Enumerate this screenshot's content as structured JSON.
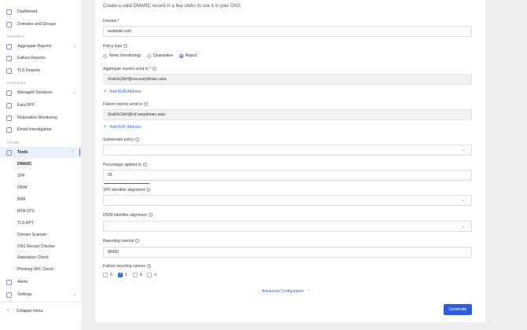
{
  "sidebar": {
    "top_items": [
      {
        "label": "Dashboard",
        "icon": "dashboard-icon"
      },
      {
        "label": "Domains and Groups",
        "icon": "domains-icon"
      }
    ],
    "reports_label": "REPORTS",
    "reports_items": [
      {
        "label": "Aggregate Reports",
        "icon": "aggregate-reports-icon",
        "chevron": "⌄"
      },
      {
        "label": "Failure Reports",
        "icon": "failure-reports-icon"
      },
      {
        "label": "TLS Reports",
        "icon": "tls-reports-icon"
      }
    ],
    "features_label": "FEATURES",
    "features_items": [
      {
        "label": "Managed Solutions",
        "icon": "managed-solutions-icon",
        "chevron": "⌄"
      },
      {
        "label": "EasySPF",
        "icon": "easyspf-icon"
      },
      {
        "label": "Reputation Monitoring",
        "icon": "reputation-monitoring-icon"
      },
      {
        "label": "Email Investigation",
        "icon": "email-investigation-icon"
      }
    ],
    "other_label": "OTHER",
    "tools": {
      "label": "Tools",
      "icon": "tools-icon",
      "chevron": "⌃"
    },
    "tools_sub": [
      "DMARC",
      "SPF",
      "DKIM",
      "BIMI",
      "MTA-STS",
      "TLS-RPT",
      "Domain Scanner",
      "DNS Record Checker",
      "Reputation Check",
      "Phishing URL Check"
    ],
    "alerts": {
      "label": "Alerts",
      "icon": "alerts-icon"
    },
    "settings": {
      "label": "Settings",
      "icon": "settings-icon",
      "chevron": "⌄"
    },
    "collapse_label": "Collapse menu"
  },
  "form": {
    "intro": "Create a valid DMARC record in a few clicks to use it in your DNS.",
    "domain_label": "Domain *",
    "domain_value": "example.com",
    "policy_label": "Policy type",
    "policy_options": [
      "None (monitoring)",
      "Quarantine",
      "Reject"
    ],
    "policy_selected": "Reject",
    "rua_label": "Aggregate reports send to *",
    "rua_value": "9cab3c2dcf@rua.easydmarc.asia",
    "add_rua": "Add RUA Address",
    "ruf_label": "Failure reports send to",
    "ruf_value": "9cab3c2dcf@ruf.easydmarc.asia",
    "add_ruf": "Add RUF Address",
    "subdomain_label": "Subdomain policy",
    "subdomain_value": "-",
    "pct_label": "Percentage applied to",
    "pct_value": "25",
    "spf_align_label": "SPF identifier alignment",
    "spf_align_value": "-",
    "dkim_align_label": "DKIM identifier alignment",
    "dkim_align_value": "-",
    "interval_label": "Reporting interval",
    "interval_value": "86400",
    "fo_label": "Failure reporting options",
    "fo_options": [
      "0",
      "1",
      "d",
      "s"
    ],
    "fo_checked": [
      "1"
    ],
    "advanced": "Advanced Configuration",
    "generate": "Generate"
  },
  "colors": {
    "accent": "#2d5be3",
    "error_line": "#d93025"
  }
}
